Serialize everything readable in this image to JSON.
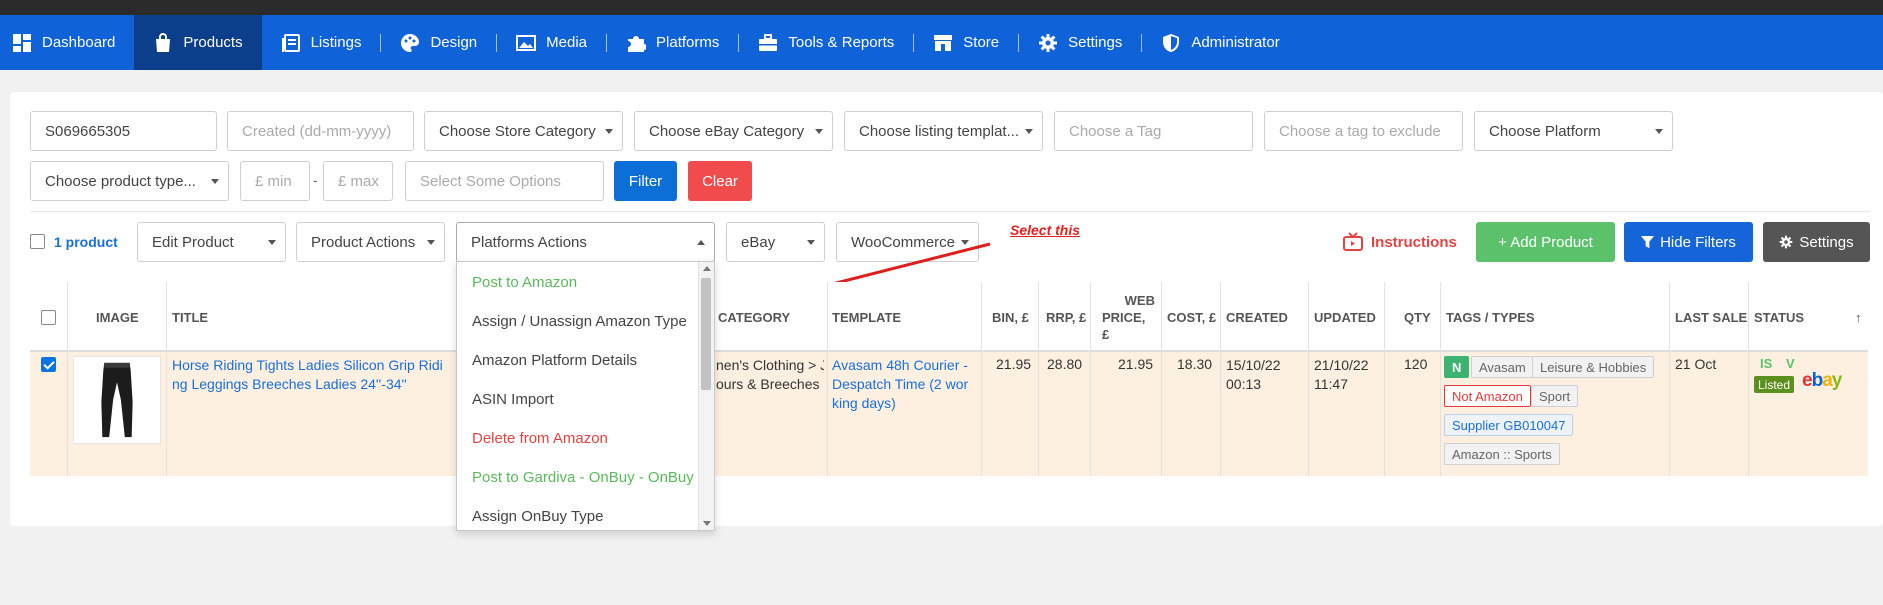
{
  "nav": {
    "items": [
      {
        "label": "Dashboard",
        "icon": "dashboard-icon"
      },
      {
        "label": "Products",
        "icon": "shopping-bag-icon"
      },
      {
        "label": "Listings",
        "icon": "listings-icon"
      },
      {
        "label": "Design",
        "icon": "palette-icon"
      },
      {
        "label": "Media",
        "icon": "image-icon"
      },
      {
        "label": "Platforms",
        "icon": "puzzle-icon"
      },
      {
        "label": "Tools & Reports",
        "icon": "toolbox-icon"
      },
      {
        "label": "Store",
        "icon": "store-icon"
      },
      {
        "label": "Settings",
        "icon": "gear-icon"
      },
      {
        "label": "Administrator",
        "icon": "shield-icon"
      }
    ]
  },
  "filters": {
    "sku_value": "S069665305",
    "created_placeholder": "Created (dd-mm-yyyy)",
    "store_category": "Choose Store Category",
    "ebay_category": "Choose eBay Category",
    "listing_template": "Choose listing templat...",
    "tag_placeholder": "Choose a Tag",
    "tag_exclude_placeholder": "Choose a tag to exclude",
    "platform": "Choose Platform",
    "product_type": "Choose product type...",
    "min_placeholder": "£ min",
    "range_sep": "-",
    "max_placeholder": "£ max",
    "options_placeholder": "Select Some Options",
    "filter_label": "Filter",
    "clear_label": "Clear"
  },
  "toolbar": {
    "count_label": "1 product",
    "edit_product": "Edit Product",
    "product_actions": "Product Actions",
    "platforms_actions": "Platforms Actions",
    "ebay": "eBay",
    "woocommerce": "WooCommerce",
    "instructions": "Instructions",
    "add_product": "+ Add Product",
    "hide_filters": "Hide Filters",
    "settings": "Settings"
  },
  "annotation": {
    "text": "Select this"
  },
  "dropdown": {
    "items": [
      {
        "label": "Post to Amazon",
        "style": "green"
      },
      {
        "label": "Assign / Unassign Amazon Type",
        "style": "normal"
      },
      {
        "label": "Amazon Platform Details",
        "style": "normal"
      },
      {
        "label": "ASIN Import",
        "style": "normal"
      },
      {
        "label": "Delete from Amazon",
        "style": "red"
      },
      {
        "label": "Post to Gardiva - OnBuy - OnBuy",
        "style": "green"
      },
      {
        "label": "Assign OnBuy Type",
        "style": "normal"
      }
    ]
  },
  "table": {
    "headers": {
      "image": "IMAGE",
      "title": "TITLE",
      "category": "CATEGORY",
      "template": "TEMPLATE",
      "bin": "BIN, £",
      "rrp": "RRP, £",
      "web_price_1": "WEB",
      "web_price_2": "PRICE, £",
      "cost": "COST, £",
      "created": "CREATED",
      "updated": "UPDATED",
      "qty": "QTY",
      "tags": "TAGS / TYPES",
      "last_sale": "LAST SALE",
      "status": "STATUS",
      "sort_arrow": "↑"
    },
    "row": {
      "title_line1": "Horse Riding Tights Ladies Silicon Grip Ridi",
      "title_line2": "ng Leggings Breeches Ladies 24''-34''",
      "category_line1": "nen's Clothing > J",
      "category_line2": "ours & Breeches",
      "template_line1": "Avasam 48h Courier -",
      "template_line2": "Despatch Time (2 wor",
      "template_line3": "king days)",
      "bin": "21.95",
      "rrp": "28.80",
      "web_price": "21.95",
      "cost": "18.30",
      "created_date": "15/10/22",
      "created_time": "00:13",
      "updated_date": "21/10/22",
      "updated_time": "11:47",
      "qty": "120",
      "tags": [
        "N",
        "Avasam",
        "Leisure & Hobbies",
        "Not Amazon",
        "Sport",
        "Supplier GB010047",
        "Amazon :: Sports"
      ],
      "last_sale": "21 Oct",
      "status_is": "IS",
      "status_v": "V",
      "listed": "Listed",
      "ebay_logo": "ebay"
    }
  },
  "colors": {
    "nav_bg": "#0f62d8",
    "nav_active": "#0b3f8c",
    "filter_btn": "#0b6fd7",
    "clear_btn": "#f24b4b",
    "add_btn": "#5cc16b",
    "hide_btn": "#1565d8",
    "settings_btn": "#555555",
    "row_bg": "#fdf0e1"
  }
}
